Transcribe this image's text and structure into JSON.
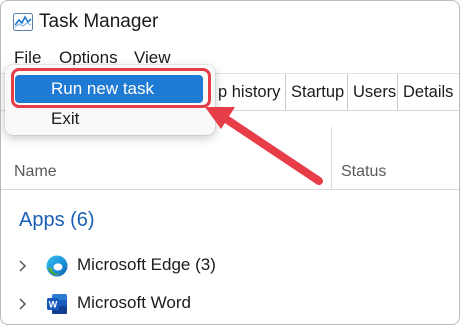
{
  "window": {
    "title": "Task Manager"
  },
  "menubar": {
    "file": "File",
    "options": "Options",
    "view": "View"
  },
  "tabs": [
    "p history",
    "Startup",
    "Users",
    "Details"
  ],
  "columns": {
    "name": "Name",
    "status": "Status"
  },
  "groups": [
    {
      "title": "Apps (6)",
      "items": [
        {
          "label": "Microsoft Edge (3)",
          "icon": "edge-icon"
        },
        {
          "label": "Microsoft Word",
          "icon": "word-icon"
        }
      ]
    }
  ],
  "file_menu": {
    "items": [
      "Run new task",
      "Exit"
    ],
    "selected": "Run new task"
  },
  "annotation": {
    "color": "#e63d48"
  },
  "colors": {
    "accent": "#1f7ad3",
    "group_title": "#1a5fb4"
  }
}
